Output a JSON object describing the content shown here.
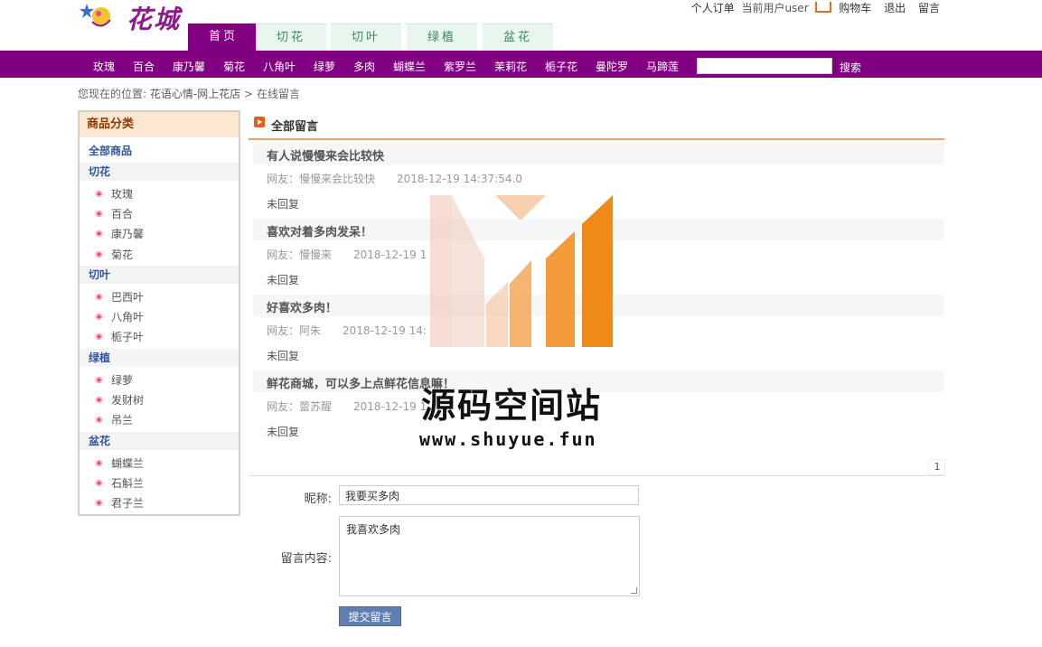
{
  "header": {
    "logo_text": "花城",
    "top_links": {
      "orders": "个人订单",
      "current_user": "当前用户user",
      "cart": "购物车",
      "logout": "退出",
      "messages": "留言"
    },
    "tabs": [
      {
        "label": "首页"
      },
      {
        "label": "切花"
      },
      {
        "label": "切叶"
      },
      {
        "label": "绿植"
      },
      {
        "label": "盆花"
      }
    ]
  },
  "nav": {
    "items": [
      "玫瑰",
      "百合",
      "康乃馨",
      "菊花",
      "八角叶",
      "绿萝",
      "多肉",
      "蝴蝶兰",
      "紫罗兰",
      "茉莉花",
      "栀子花",
      "曼陀罗",
      "马蹄莲"
    ],
    "search_value": "",
    "search_button": "搜索"
  },
  "breadcrumb": {
    "prefix": "您现在的位置:",
    "home": "花语心情-网上花店",
    "sep": ">",
    "current": "在线留言"
  },
  "sidebar": {
    "title": "商品分类",
    "all": "全部商品",
    "categories": [
      {
        "name": "切花",
        "items": [
          "玫瑰",
          "百合",
          "康乃馨",
          "菊花"
        ]
      },
      {
        "name": "切叶",
        "items": [
          "巴西叶",
          "八角叶",
          "栀子叶"
        ]
      },
      {
        "name": "绿植",
        "items": [
          "绿萝",
          "发财树",
          "吊兰"
        ]
      },
      {
        "name": "盆花",
        "items": [
          "蝴蝶兰",
          "石斛兰",
          "君子兰"
        ]
      }
    ]
  },
  "main": {
    "title": "全部留言",
    "messages": [
      {
        "title": "有人说慢慢来会比较快",
        "author": "网友：慢慢来会比较快",
        "time": "2018-12-19 14:37:54.0",
        "reply": "未回复"
      },
      {
        "title": "喜欢对着多肉发呆！",
        "author": "网友：慢慢来",
        "time": "2018-12-19 1",
        "reply": "未回复"
      },
      {
        "title": "好喜欢多肉！",
        "author": "网友：阿朱",
        "time": "2018-12-19 14:",
        "reply": "未回复"
      },
      {
        "title": "鲜花商城，可以多上点鲜花信息嘛！",
        "author": "网友：蕾苏醒",
        "time": "2018-12-19 1",
        "reply": "未回复"
      }
    ],
    "page": "1"
  },
  "form": {
    "nickname_label": "昵称:",
    "nickname_value": "我要买多肉",
    "content_label": "留言内容:",
    "content_value": "我喜欢多肉",
    "submit": "提交留言"
  },
  "watermark": {
    "name": "源码空间站",
    "url": "www.shuyue.fun"
  },
  "colors": {
    "brand_purple": "#800080",
    "tab_green": "#e8f6ee",
    "accent_orange": "#f0a060",
    "button_blue": "#5f7fb0"
  }
}
